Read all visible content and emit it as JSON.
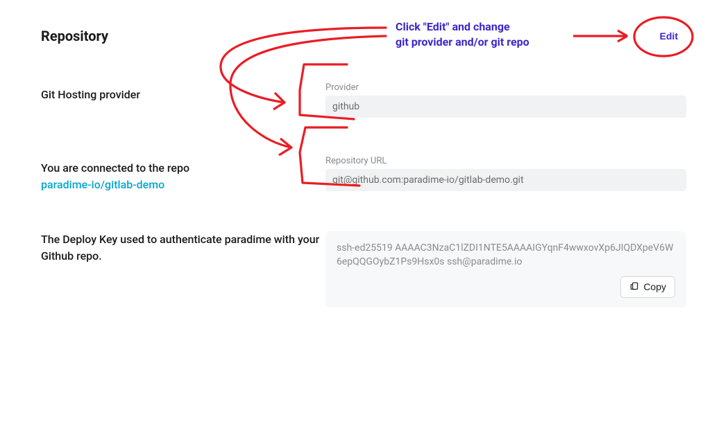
{
  "header": {
    "title": "Repository",
    "edit_label": "Edit"
  },
  "provider": {
    "left_label": "Git Hosting provider",
    "field_label": "Provider",
    "value": "github"
  },
  "repo": {
    "left_label_prefix": "You are connected to the repo",
    "repo_link_text": "paradime-io/gitlab-demo",
    "field_label": "Repository URL",
    "value": "git@github.com:paradime-io/gitlab-demo.git"
  },
  "deploy": {
    "left_label": "The Deploy Key used to authenticate paradime with your Github repo.",
    "key": "ssh-ed25519 AAAAC3NzaC1lZDI1NTE5AAAAIGYqnF4wwxovXp6JIQDXpeV6W6epQQGOybZ1Ps9Hsx0s ssh@paradime.io",
    "copy_label": "Copy"
  },
  "annotation": {
    "line1": "Click \"Edit\" and change",
    "line2": "git provider and/or git repo"
  }
}
